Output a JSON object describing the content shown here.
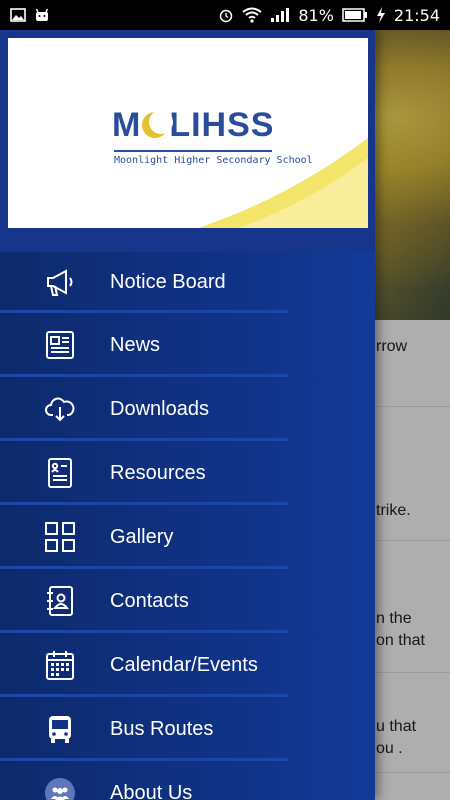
{
  "status_bar": {
    "battery": "81%",
    "time": "21:54"
  },
  "background": {
    "lines": [
      "rrow",
      "trike.",
      "n the",
      " on that",
      "u that",
      "ou ."
    ]
  },
  "header": {
    "logo_title_left": "M",
    "logo_title_right": "LIHSS",
    "logo_subtitle": "Moonlight Higher Secondary School"
  },
  "menu": {
    "items": [
      {
        "label": "Notice Board",
        "icon": "megaphone-icon"
      },
      {
        "label": "News",
        "icon": "newspaper-icon"
      },
      {
        "label": "Downloads",
        "icon": "cloud-download-icon"
      },
      {
        "label": "Resources",
        "icon": "document-icon"
      },
      {
        "label": "Gallery",
        "icon": "grid-icon"
      },
      {
        "label": "Contacts",
        "icon": "address-book-icon"
      },
      {
        "label": "Calendar/Events",
        "icon": "calendar-icon"
      },
      {
        "label": "Bus Routes",
        "icon": "bus-icon"
      },
      {
        "label": "About Us",
        "icon": "group-icon"
      }
    ]
  },
  "colors": {
    "drawer": "#103184",
    "accent_yellow": "#f3e46a",
    "logo_blue": "#2a4c9c"
  }
}
